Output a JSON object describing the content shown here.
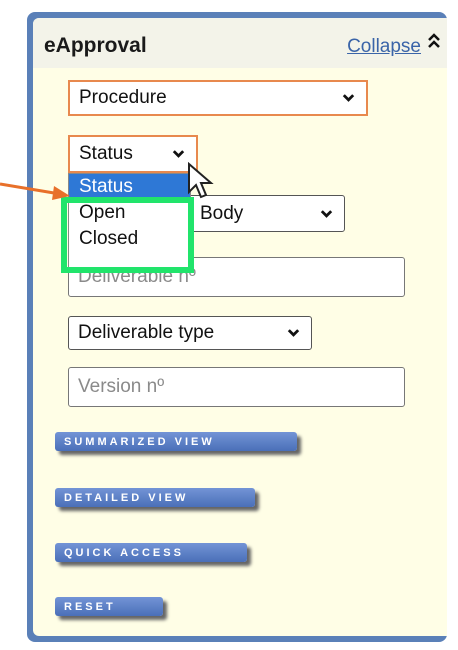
{
  "panel": {
    "title": "eApproval",
    "collapse_label": "Collapse",
    "collapse_icon": "double-chevron-up-icon"
  },
  "filters": {
    "procedure": "Procedure",
    "status": "Status",
    "body": "Body",
    "deliverable_no_placeholder": "Deliverable nº",
    "deliverable_type": "Deliverable type",
    "version_no_placeholder": "Version nº"
  },
  "status_dropdown": {
    "options": [
      "Status",
      "Open",
      "Closed"
    ],
    "selected": "Status"
  },
  "buttons": {
    "summarized": "SUMMARIZED VIEW",
    "detailed": "DETAILED VIEW",
    "quick_access": "QUICK ACCESS",
    "reset": "RESET"
  },
  "colors": {
    "highlight": "#21e46b",
    "arrow": "#e8702a",
    "panel_border": "#5a80b8"
  }
}
